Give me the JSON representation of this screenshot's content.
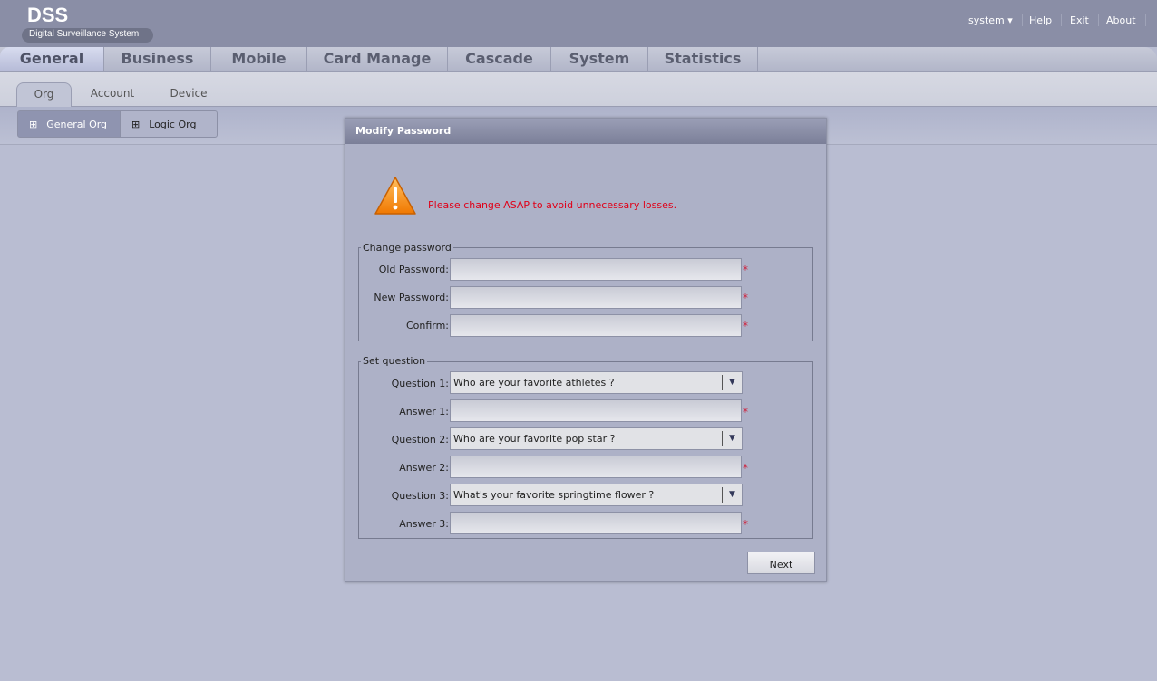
{
  "header": {
    "logo": "DSS",
    "subtitle": "Digital Surveillance System",
    "user": "system",
    "links": [
      "Help",
      "Exit",
      "About"
    ]
  },
  "main_tabs": [
    "General",
    "Business",
    "Mobile",
    "Card Manage",
    "Cascade",
    "System",
    "Statistics"
  ],
  "sub_tabs": [
    "Org",
    "Account",
    "Device"
  ],
  "toolbar": {
    "general_org": "General Org",
    "logic_org": "Logic Org"
  },
  "dialog": {
    "title": "Modify Password",
    "warning": "Please change ASAP to avoid unnecessary losses.",
    "change_legend": "Change password",
    "old_label": "Old Password:",
    "new_label": "New Password:",
    "confirm_label": "Confirm:",
    "question_legend": "Set question",
    "q1_label": "Question 1:",
    "q1_value": "Who are your favorite athletes ?",
    "a1_label": "Answer 1:",
    "q2_label": "Question 2:",
    "q2_value": "Who are your favorite pop star ?",
    "a2_label": "Answer 2:",
    "q3_label": "Question 3:",
    "q3_value": "What's your favorite springtime flower ?",
    "a3_label": "Answer 3:",
    "required": "*",
    "next": "Next"
  }
}
